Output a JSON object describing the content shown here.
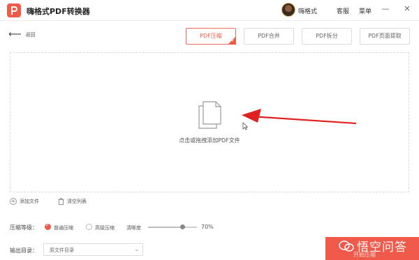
{
  "app": {
    "title": "嗨格式PDF转换器",
    "user_name": "嗨格式",
    "service_label": "客服",
    "menu_label": "菜单",
    "brand_color": "#ef5a4a"
  },
  "window_controls": [
    {
      "name": "minimize",
      "glyph": "—"
    },
    {
      "name": "close",
      "glyph": "✕"
    }
  ],
  "toolbar": {
    "back_label": "返回",
    "tabs": [
      {
        "label": "PDF压缩",
        "active": true
      },
      {
        "label": "PDF合并",
        "active": false
      },
      {
        "label": "PDF拆分",
        "active": false
      },
      {
        "label": "PDF页面提取",
        "active": false
      }
    ]
  },
  "dropzone": {
    "hint": "点击或拖拽添加PDF文件",
    "icon": "document-stack-icon"
  },
  "actions": {
    "add_file": "添加文件",
    "clear_list": "清空列表"
  },
  "compression": {
    "label": "压缩等级：",
    "options": [
      {
        "label": "普通压缩",
        "selected": true
      },
      {
        "label": "高级压缩",
        "selected": false
      }
    ],
    "clarity_label": "清晰度",
    "clarity_value": 70,
    "clarity_text": "70%"
  },
  "output": {
    "label": "输出目录：",
    "selected": "原文件目录"
  },
  "start_button": {
    "label": "开始压缩"
  },
  "watermark": {
    "text": "悟空问答"
  }
}
